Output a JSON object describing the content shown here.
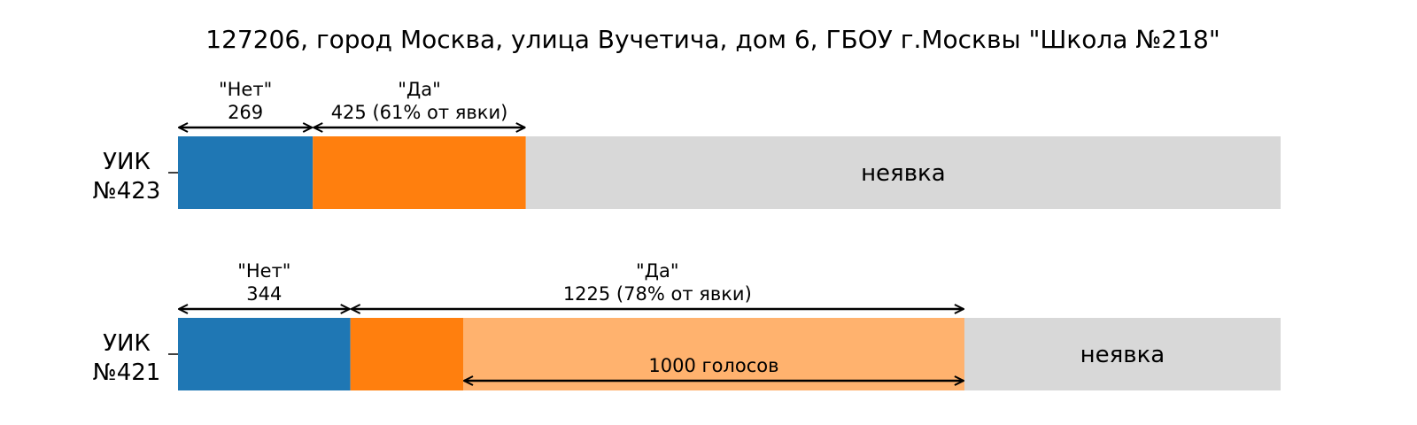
{
  "chart_data": {
    "type": "bar",
    "title": "127206, город Москва, улица Вучетича, дом 6, ГБОУ г.Москвы \"Школа №218\"",
    "colors": {
      "no": "#1f77b4",
      "yes": "#ff7f0e",
      "excess": "#ffb26e",
      "noshow": "#d8d8d8"
    },
    "bars": [
      {
        "label_lines": [
          "УИК",
          "№423"
        ],
        "no": 269,
        "yes": 425,
        "noshow_total": 2200,
        "no_label": "\"Нет\"",
        "no_value_label": "269",
        "yes_label": "\"Да\"",
        "yes_value_label": "425 (61% от явки)",
        "noshow_label": "неявка",
        "excess": null,
        "excess_label": ""
      },
      {
        "label_lines": [
          "УИК",
          "№421"
        ],
        "no": 344,
        "yes": 1225,
        "noshow_total": 2200,
        "no_label": "\"Нет\"",
        "no_value_label": "344",
        "yes_label": "\"Да\"",
        "yes_value_label": "1225 (78% от явки)",
        "noshow_label": "неявка",
        "excess": 1000,
        "excess_label": "1000 голосов"
      }
    ]
  }
}
